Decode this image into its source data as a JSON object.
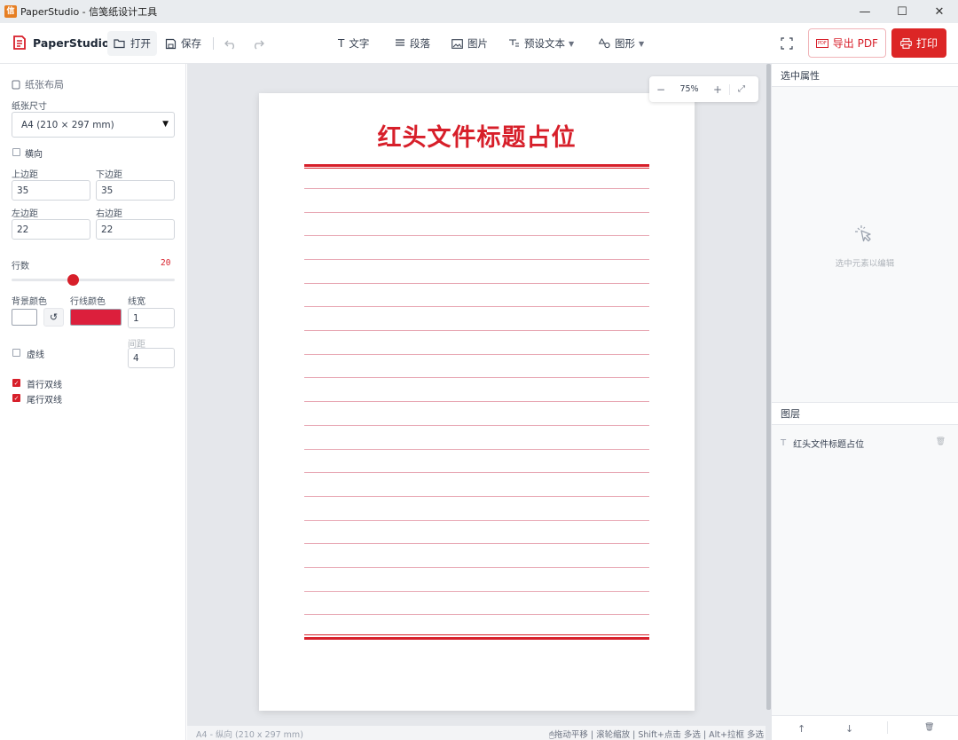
{
  "window": {
    "app_icon_char": "信",
    "title": "PaperStudio - 信笺纸设计工具",
    "controls": [
      "—",
      "☐",
      "✕"
    ]
  },
  "toolbar": {
    "brand": "PaperStudio",
    "open": "打开",
    "save": "保存",
    "text": "文字",
    "paragraph": "段落",
    "image": "图片",
    "preset_text": "预设文本",
    "shape": "图形",
    "export_pdf": "导出 PDF",
    "pdf_badge": "PDF",
    "print": "打印"
  },
  "left_panel": {
    "section_title": "纸张布局",
    "paper_size_label": "纸张尺寸",
    "paper_size_value": "A4 (210 × 297 mm)",
    "landscape_label": "横向",
    "landscape_checked": false,
    "top_margin_label": "上边距",
    "top_margin_value": "35",
    "bottom_margin_label": "下边距",
    "bottom_margin_value": "35",
    "left_margin_label": "左边距",
    "left_margin_value": "22",
    "right_margin_label": "右边距",
    "right_margin_value": "22",
    "rows_label": "行数",
    "rows_value": "20",
    "rows_slider_fraction": 0.375,
    "bg_color_label": "背景颜色",
    "bg_color": "#ffffff",
    "line_color_label": "行线颜色",
    "line_color": "#dc1f3c",
    "line_width_label": "线宽",
    "line_width_value": "1",
    "dashed_label": "虚线",
    "dashed_checked": false,
    "gap_label": "间距",
    "gap_value": "4",
    "first_double_label": "首行双线",
    "first_double_checked": true,
    "last_double_label": "尾行双线",
    "last_double_checked": true
  },
  "canvas": {
    "zoom": "75%",
    "paper_title": "红头文件标题占位",
    "status_left": "A4 - 纵向 (210 x 297 mm)",
    "status_right": "🖱拖动平移 | 滚轮缩放 | Shift+点击 多选 | Alt+拉框 多选"
  },
  "right_panel": {
    "props_title": "选中属性",
    "empty_hint": "选中元素以编辑",
    "layers_title": "图层",
    "layers": [
      {
        "type_icon": "T",
        "name": "红头文件标题占位"
      }
    ]
  },
  "colors": {
    "accent": "#d71f2a",
    "rule_light": "#e8a8b4"
  }
}
